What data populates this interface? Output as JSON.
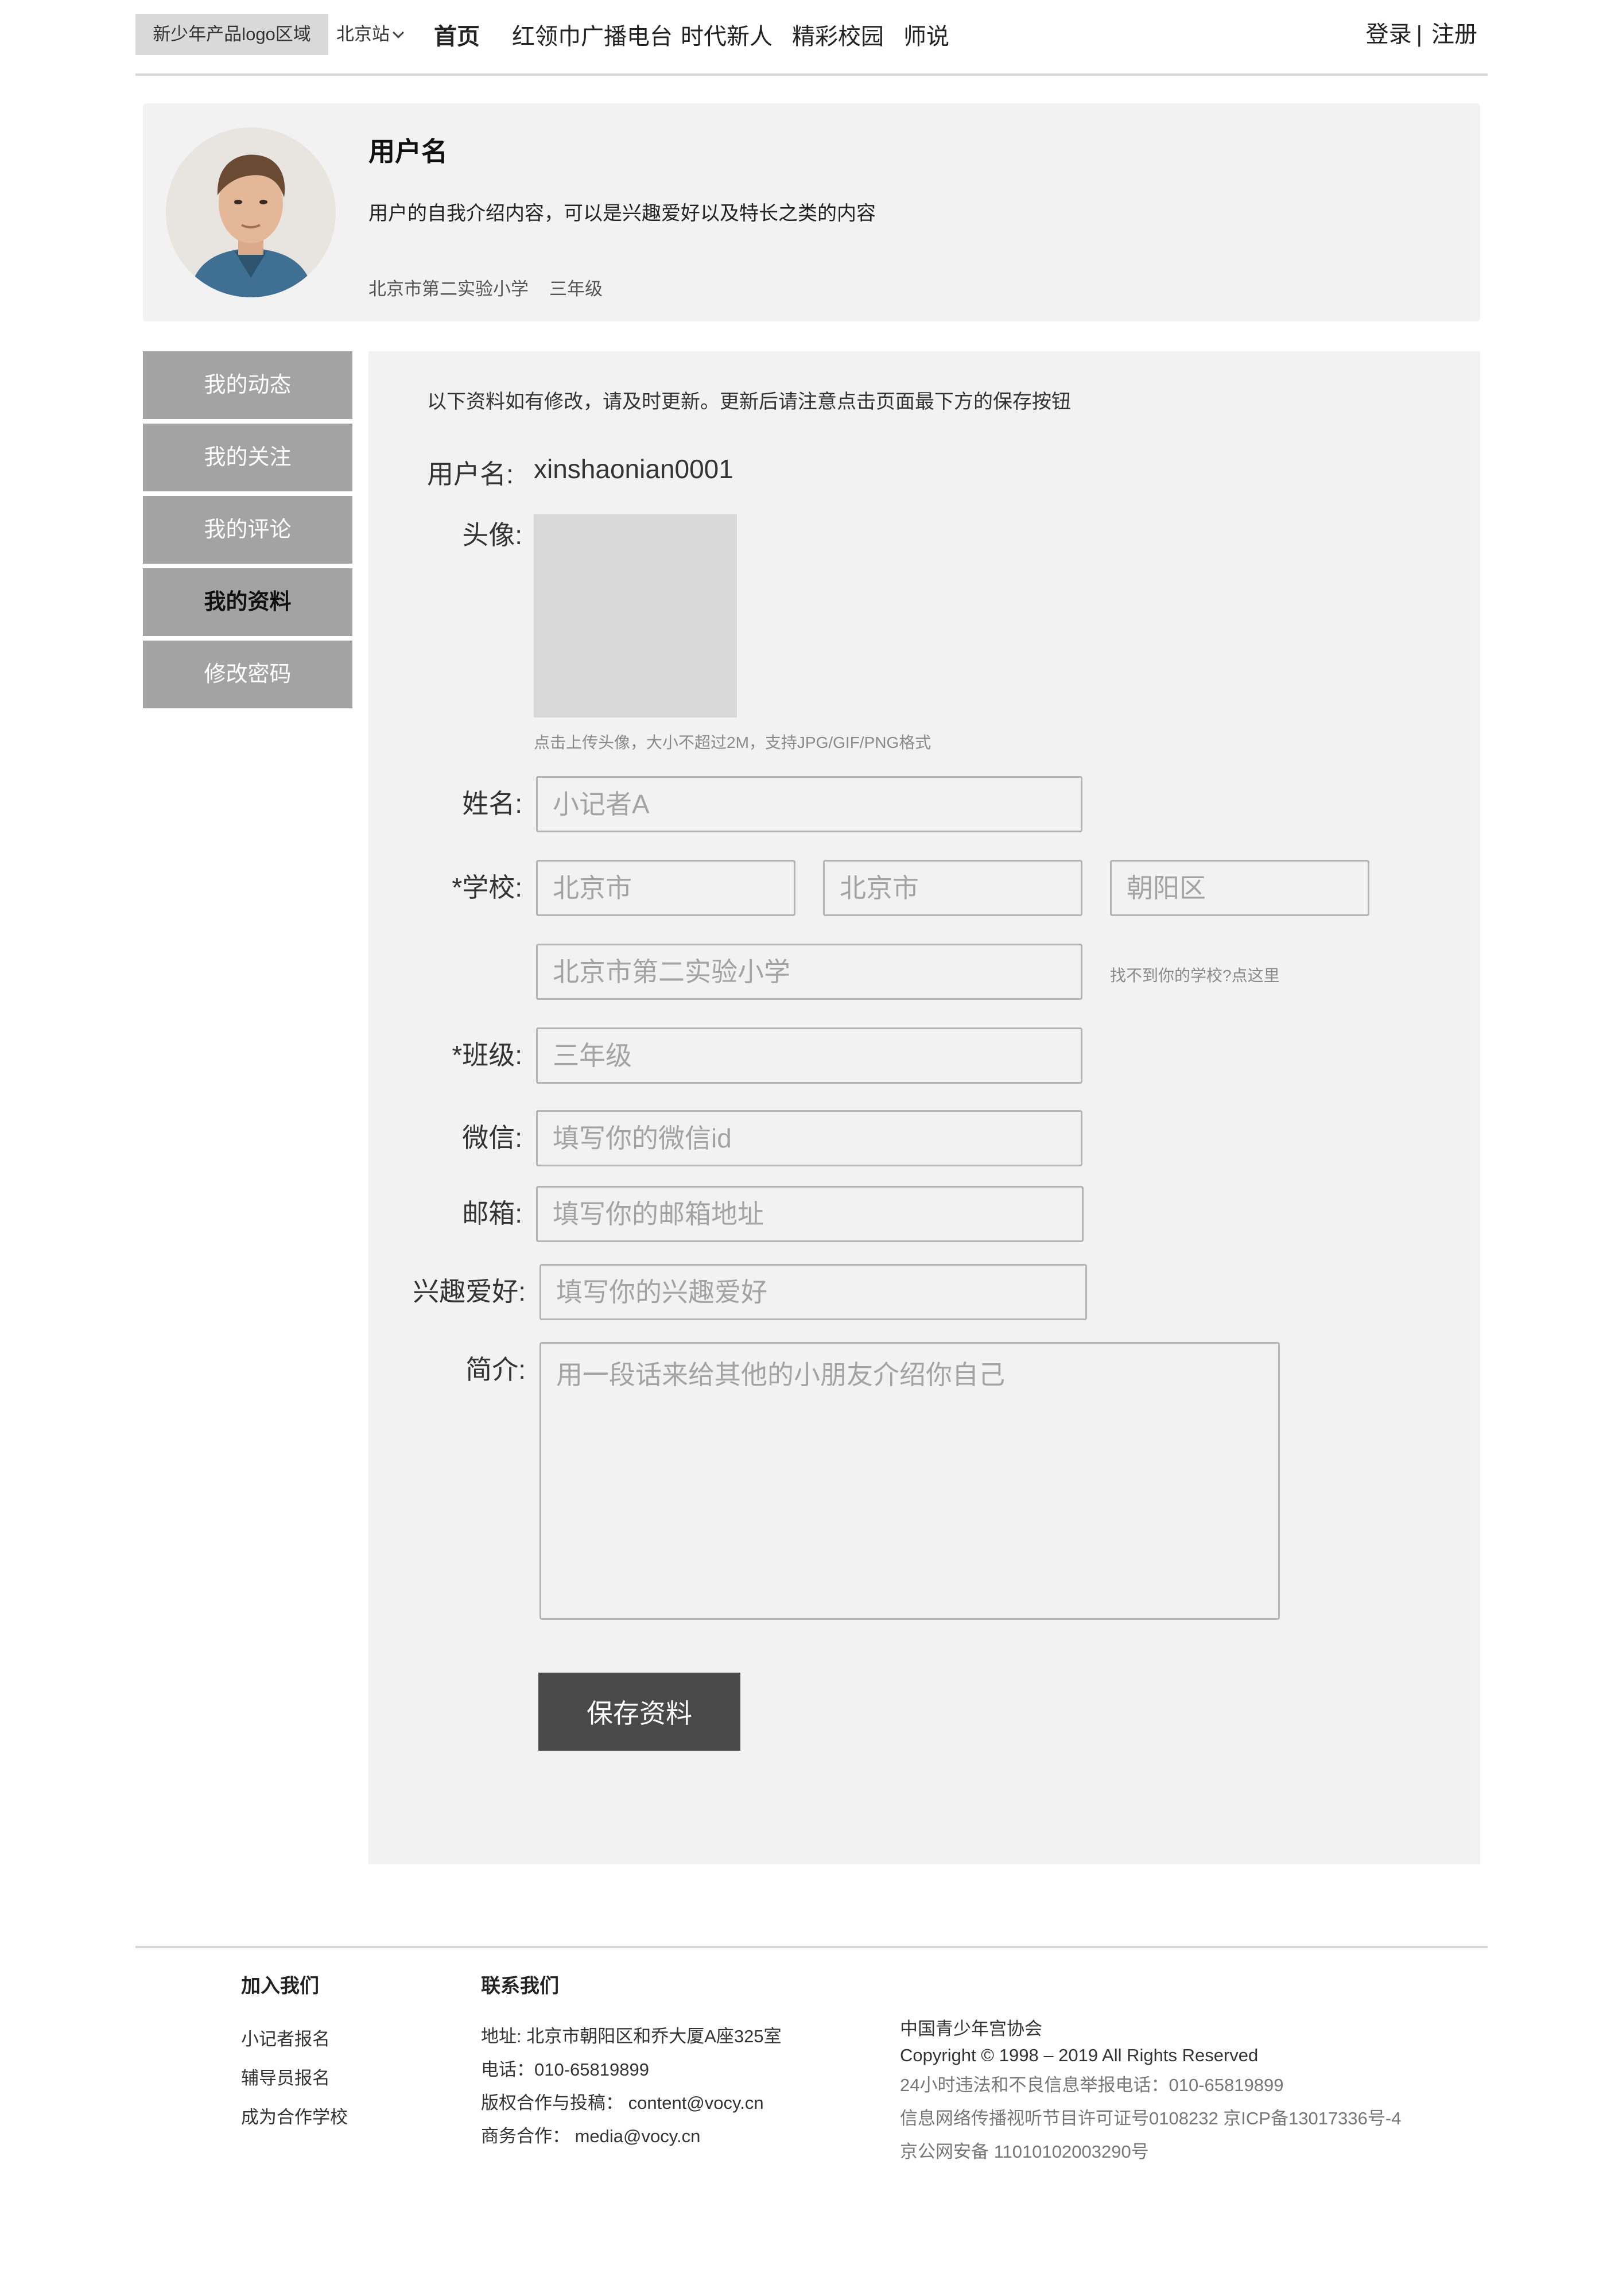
{
  "header": {
    "logo_text": "新少年产品logo区域",
    "city": "北京站",
    "nav": [
      "首页",
      "红领巾广播电台",
      "时代新人",
      "精彩校园",
      "师说"
    ],
    "login": "登录",
    "separator": "|",
    "register": "注册"
  },
  "profile": {
    "username": "用户名",
    "bio": "用户的自我介绍内容，可以是兴趣爱好以及特长之类的内容",
    "school": "北京市第二实验小学",
    "grade": "三年级"
  },
  "sidebar": {
    "items": [
      {
        "label": "我的动态",
        "active": false
      },
      {
        "label": "我的关注",
        "active": false
      },
      {
        "label": "我的评论",
        "active": false
      },
      {
        "label": "我的资料",
        "active": true
      },
      {
        "label": "修改密码",
        "active": false
      }
    ]
  },
  "form": {
    "notice": "以下资料如有修改，请及时更新。更新后请注意点击页面最下方的保存按钮",
    "username_label": "用户名:",
    "username_value": "xinshaonian0001",
    "avatar_label": "头像:",
    "avatar_hint": "点击上传头像，大小不超过2M，支持JPG/GIF/PNG格式",
    "name_label": "姓名:",
    "name_placeholder": "小记者A",
    "school_label": "*学校:",
    "province_placeholder": "北京市",
    "city_placeholder": "北京市",
    "district_placeholder": "朝阳区",
    "school_placeholder": "北京市第二实验小学",
    "school_missing_link": "找不到你的学校?点这里",
    "class_label": "*班级:",
    "class_placeholder": "三年级",
    "wechat_label": "微信:",
    "wechat_placeholder": "填写你的微信id",
    "email_label": "邮箱:",
    "email_placeholder": "填写你的邮箱地址",
    "hobby_label": "兴趣爱好:",
    "hobby_placeholder": "填写你的兴趣爱好",
    "intro_label": "简介:",
    "intro_placeholder": "用一段话来给其他的小朋友介绍你自己",
    "save_label": "保存资料"
  },
  "footer": {
    "join": {
      "title": "加入我们",
      "links": [
        "小记者报名",
        "辅导员报名",
        "成为合作学校"
      ]
    },
    "contact": {
      "title": "联系我们",
      "lines": [
        "地址: 北京市朝阳区和乔大厦A座325室",
        "电话：010-65819899",
        "版权合作与投稿： content@vocy.cn",
        "商务合作： media@vocy.cn"
      ]
    },
    "org": {
      "name": "中国青少年宫协会",
      "copyright": "Copyright © 1998 – 2019 All Rights Reserved",
      "lines": [
        "24小时违法和不良信息举报电话：010-65819899",
        "信息网络传播视听节目许可证号0108232 京ICP备13017336号-4",
        "京公网安备 11010102003290号"
      ]
    }
  }
}
